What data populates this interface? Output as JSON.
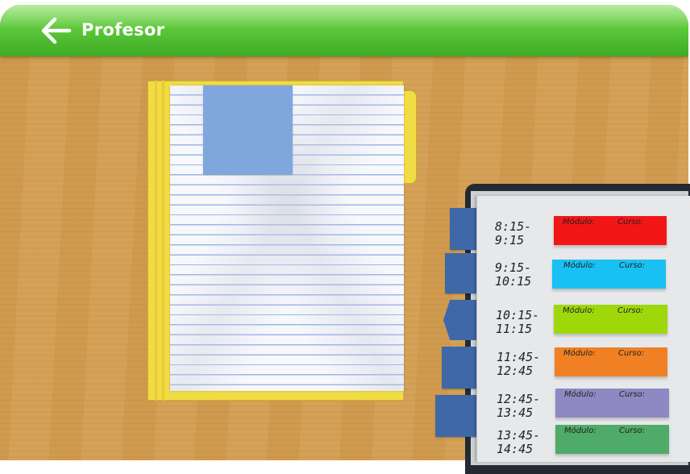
{
  "header": {
    "title": "Profesor",
    "back_icon": "arrow-left-icon"
  },
  "schedule": {
    "slots": [
      {
        "start": "8:15-",
        "end": "9:15",
        "modulo_label": "Módulo:",
        "curso_label": "Curso:",
        "color": "#f21616"
      },
      {
        "start": "9:15-",
        "end": "10:15",
        "modulo_label": "Módulo:",
        "curso_label": "Curso:",
        "color": "#19c0f3"
      },
      {
        "start": "10:15-",
        "end": "11:15",
        "modulo_label": "Módulo:",
        "curso_label": "Curso:",
        "color": "#9ed80b"
      },
      {
        "start": "11:45-",
        "end": "12:45",
        "modulo_label": "Módulo:",
        "curso_label": "Curso:",
        "color": "#f08023"
      },
      {
        "start": "12:45-",
        "end": "13:45",
        "modulo_label": "Módulo:",
        "curso_label": "Curso:",
        "color": "#8f88c2"
      },
      {
        "start": "13:45-",
        "end": "14:45",
        "modulo_label": "Módulo:",
        "curso_label": "Curso:",
        "color": "#4fab68"
      }
    ]
  },
  "colors": {
    "header_green": "#5cc83a",
    "desk_wood": "#d39e51",
    "folder_yellow": "#f2dc46",
    "sticky_note_blue": "#80a7dd",
    "planner_tab_blue": "#3f68a8"
  }
}
